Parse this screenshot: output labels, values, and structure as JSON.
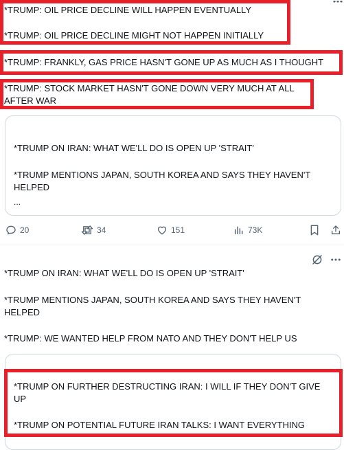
{
  "post1": {
    "lines": [
      "*TRUMP: OIL PRICE DECLINE WILL HAPPEN EVENTUALLY",
      "*TRUMP: OIL PRICE DECLINE MIGHT NOT HAPPEN INITIALLY",
      "*TRUMP: FRANKLY, GAS PRICE HASN'T GONE UP AS MUCH AS I THOUGHT",
      "*TRUMP: STOCK MARKET HASN'T GONE DOWN VERY MUCH AT ALL",
      "AFTER WAR"
    ]
  },
  "quoted1": {
    "lines": [
      "*TRUMP ON IRAN: WHAT WE'LL DO IS OPEN UP 'STRAIT'",
      "*TRUMP MENTIONS JAPAN, SOUTH KOREA AND SAYS THEY HAVEN'T",
      "HELPED",
      "..."
    ]
  },
  "actions": {
    "replies": "20",
    "reposts": "34",
    "likes": "151",
    "views": "73K"
  },
  "post2": {
    "lines": [
      "*TRUMP ON IRAN: WHAT WE'LL DO IS OPEN UP 'STRAIT'",
      "*TRUMP MENTIONS JAPAN, SOUTH KOREA AND SAYS THEY HAVEN'T",
      "HELPED",
      "*TRUMP: WE WANTED HELP FROM NATO AND THEY DON'T HELP US"
    ]
  },
  "quoted2": {
    "lines": [
      "*TRUMP ON FURTHER DESTRUCTING IRAN: I WILL IF THEY DON'T GIVE",
      "UP",
      "*TRUMP ON POTENTIAL FUTURE IRAN TALKS: I WANT EVERYTHING"
    ]
  },
  "colors": {
    "highlight": "#e8202a",
    "muted": "#536471",
    "border": "#cfd9de"
  },
  "icons": [
    "reply-icon",
    "repost-icon",
    "like-icon",
    "views-icon",
    "bookmark-icon",
    "share-icon",
    "grok-icon",
    "more-icon"
  ]
}
